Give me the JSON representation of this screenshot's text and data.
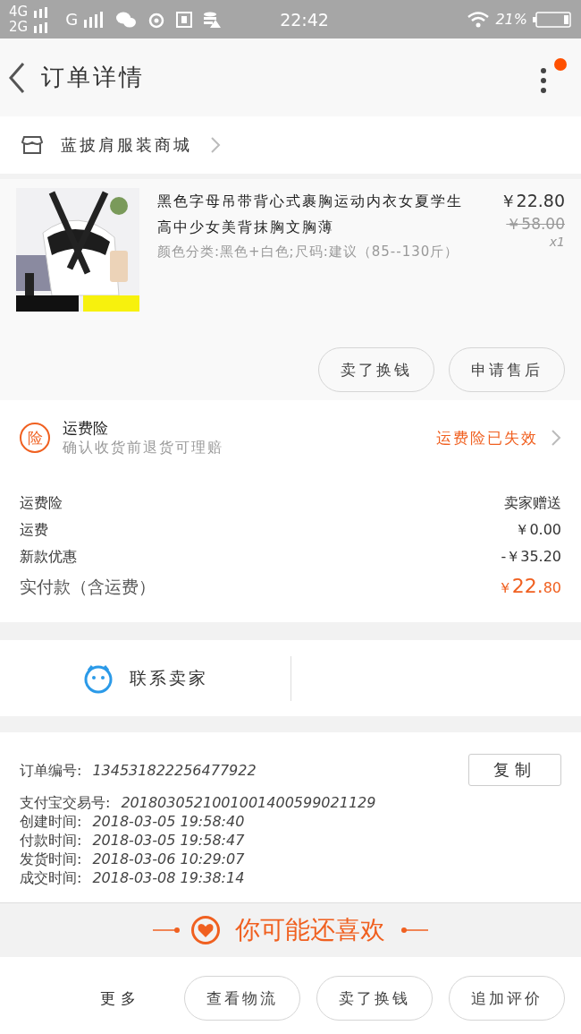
{
  "status_bar": {
    "network_1": "4G",
    "network_2": "2G",
    "network_3": "G",
    "time": "22:42",
    "battery": "21%"
  },
  "header": {
    "title": "订单详情",
    "has_notification": true
  },
  "shop": {
    "name": "蓝披肩服装商城"
  },
  "product": {
    "title": "黑色字母吊带背心式裹胸运动内衣女夏学生高中少女美背抹胸文胸薄",
    "options": "颜色分类:黑色+白色;尺码:建议（85--130斤）",
    "price": "￥22.80",
    "original_price": "￥58.00",
    "quantity": "x1",
    "buttons": [
      "卖了换钱",
      "申请售后"
    ]
  },
  "insurance": {
    "badge": "险",
    "title": "运费险",
    "subtitle": "确认收货前退货可理赔",
    "status": "运费险已失效"
  },
  "costs": [
    {
      "label": "运费险",
      "value": "卖家赠送"
    },
    {
      "label": "运费",
      "value": "￥0.00"
    },
    {
      "label": "新款优惠",
      "value": "-￥35.20"
    }
  ],
  "total": {
    "label": "实付款（含运费）",
    "currency": "￥",
    "amount": "22.",
    "cents": "80"
  },
  "contact": {
    "label": "联系卖家"
  },
  "order_info": {
    "copy_button": "复制",
    "rows": [
      {
        "label": "订单编号:",
        "value": "134531822256477922"
      },
      {
        "label": "支付宝交易号:",
        "value": "2018030521001001400599021129"
      },
      {
        "label": "创建时间:",
        "value": "2018-03-05 19:58:40"
      },
      {
        "label": "付款时间:",
        "value": "2018-03-05 19:58:47"
      },
      {
        "label": "发货时间:",
        "value": "2018-03-06 10:29:07"
      },
      {
        "label": "成交时间:",
        "value": "2018-03-08 19:38:14"
      }
    ]
  },
  "recommend": {
    "title": "你可能还喜欢"
  },
  "bottom_bar": {
    "more": "更多",
    "buttons": [
      "查看物流",
      "卖了换钱",
      "追加评价"
    ]
  }
}
